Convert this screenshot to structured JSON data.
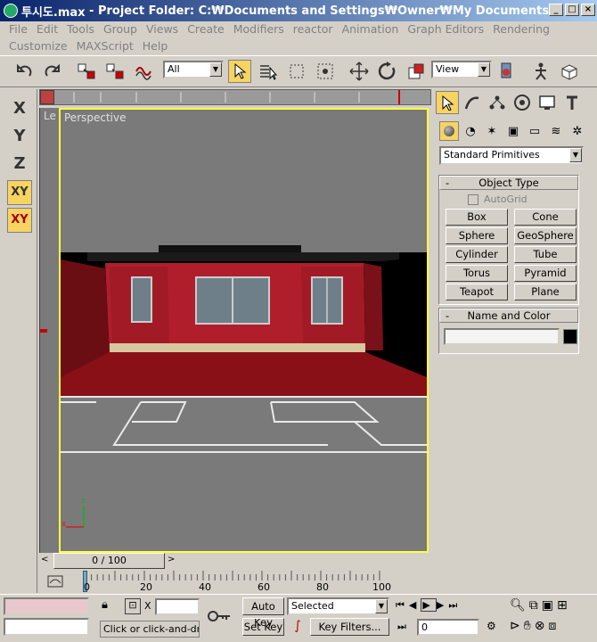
{
  "window": {
    "file_name": "투시도.max",
    "separator": " - ",
    "title_rest": "Project Folder: C:₩Documents and Settings₩Owner₩My Documents..."
  },
  "menu": [
    "File",
    "Edit",
    "Tools",
    "Group",
    "Views",
    "Create",
    "Modifiers",
    "reactor",
    "Animation",
    "Graph Editors",
    "Rendering",
    "Customize",
    "MAXScript",
    "Help"
  ],
  "toolbar": {
    "selection_filter": "All",
    "ref_coord": "View"
  },
  "axis_constraints": [
    "X",
    "Y",
    "Z",
    "XY",
    "XY"
  ],
  "viewport": {
    "label": "Perspective",
    "left_label": "Le"
  },
  "command_panel": {
    "category": "Standard Primitives",
    "object_type_title": "Object Type",
    "autogrid_label": "AutoGrid",
    "buttons": [
      "Box",
      "Cone",
      "Sphere",
      "GeoSphere",
      "Cylinder",
      "Tube",
      "Torus",
      "Pyramid",
      "Teapot",
      "Plane"
    ],
    "name_color_title": "Name and Color",
    "swatch_color": "#000000"
  },
  "timeline": {
    "position": "0 / 100",
    "ruler_labels": [
      "0",
      "20",
      "40",
      "60",
      "80",
      "100"
    ]
  },
  "status": {
    "prompt": "Click or click-and-drag",
    "coord_x_label": "X",
    "auto_key": "Auto Key",
    "set_key": "Set Key",
    "key_mode": "Selected",
    "key_filters": "Key Filters...",
    "current_frame": "0"
  },
  "colors": {
    "titlebar": "#0a246a",
    "active_button": "#f7d462",
    "viewport_border": "#ffff40",
    "wall_red": "#b01e2c",
    "floor_red": "#8a1018"
  }
}
